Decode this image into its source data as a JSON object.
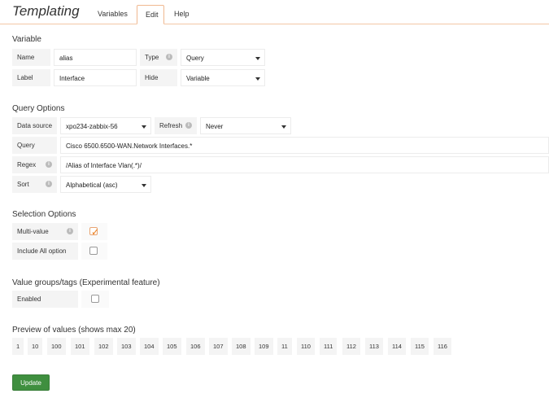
{
  "header": {
    "title": "Templating",
    "tabs": [
      "Variables",
      "Edit",
      "Help"
    ]
  },
  "variable": {
    "section_title": "Variable",
    "name_label": "Name",
    "name_value": "alias",
    "type_label": "Type",
    "type_value": "Query",
    "label_label": "Label",
    "label_value": "Interface",
    "hide_label": "Hide",
    "hide_value": "Variable"
  },
  "query_options": {
    "section_title": "Query Options",
    "datasource_label": "Data source",
    "datasource_value": "xpo234-zabbix-56",
    "refresh_label": "Refresh",
    "refresh_value": "Never",
    "query_label": "Query",
    "query_value": "Cisco 6500.6500-WAN.Network Interfaces.*",
    "regex_label": "Regex",
    "regex_value": "/Alias of Interface Vlan(.*)/",
    "sort_label": "Sort",
    "sort_value": "Alphabetical (asc)"
  },
  "selection_options": {
    "section_title": "Selection Options",
    "multivalue_label": "Multi-value",
    "multivalue_checked": true,
    "include_all_label": "Include All option",
    "include_all_checked": false
  },
  "value_groups": {
    "section_title": "Value groups/tags (Experimental feature)",
    "enabled_label": "Enabled",
    "enabled_checked": false
  },
  "preview": {
    "section_title": "Preview of values (shows max 20)",
    "values": [
      "1",
      "10",
      "100",
      "101",
      "102",
      "103",
      "104",
      "105",
      "106",
      "107",
      "108",
      "109",
      "11",
      "110",
      "111",
      "112",
      "113",
      "114",
      "115",
      "116"
    ]
  },
  "actions": {
    "update_label": "Update"
  },
  "colors": {
    "accent": "#eb7b18",
    "update_button": "#3f8f3f"
  }
}
